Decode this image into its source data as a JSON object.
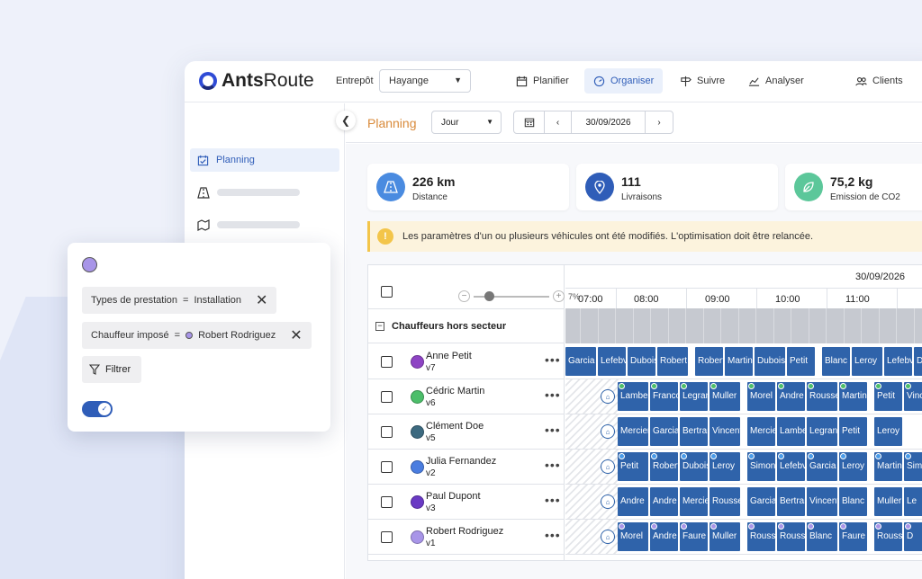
{
  "header": {
    "logo_bold": "Ants",
    "logo_rest": "Route",
    "entrepot_label": "Entrepôt",
    "entrepot_value": "Hayange",
    "nav": [
      {
        "label": "Planifier",
        "icon": "calendar-icon"
      },
      {
        "label": "Organiser",
        "icon": "speedometer-icon",
        "active": true
      },
      {
        "label": "Suivre",
        "icon": "signpost-icon"
      },
      {
        "label": "Analyser",
        "icon": "chart-icon"
      },
      {
        "label": "Clients",
        "icon": "people-icon"
      }
    ]
  },
  "sidebar": {
    "items": [
      {
        "label": "Planning",
        "icon": "calendar-check-icon"
      }
    ]
  },
  "toolbar": {
    "title": "Planning",
    "view": "Jour",
    "date": "30/09/2026"
  },
  "stats": [
    {
      "value": "226 km",
      "label": "Distance",
      "icon": "road-icon",
      "color": "#4a8be0"
    },
    {
      "value": "111",
      "label": "Livraisons",
      "icon": "pin-icon",
      "color": "#2f5db8"
    },
    {
      "value": "75,2 kg",
      "label": "Emission de CO2",
      "icon": "leaf-icon",
      "color": "#5cc79a"
    }
  ],
  "warning": {
    "text": "Les paramètres d'un ou plusieurs véhicules ont été modifiés. L'optimisation doit être relancée."
  },
  "timeline": {
    "date": "30/09/2026",
    "zoom": "7%",
    "hours": [
      "07:00",
      "08:00",
      "09:00",
      "10:00",
      "11:00"
    ],
    "section": "Chauffeurs hors secteur"
  },
  "drivers": [
    {
      "name": "Anne Petit",
      "vehicle": "v7",
      "color": "#8e44c4",
      "stop_color": null,
      "stops": [
        "Garcia",
        "Lefebvre",
        "Dubois",
        "Robert",
        "Robert",
        "Martin",
        "Dubois",
        "Petit",
        "Blanc",
        "Leroy",
        "Lefebvre",
        "Dubois"
      ]
    },
    {
      "name": "Cédric Martin",
      "vehicle": "v6",
      "color": "#4cbe6a",
      "stop_color": "#4cbe6a",
      "stops": [
        "Lambert",
        "Francois",
        "Legrand",
        "Muller",
        "Morel",
        "Andre",
        "Rousseau",
        "Martin",
        "Petit",
        "Vincent"
      ]
    },
    {
      "name": "Clément Doe",
      "vehicle": "v5",
      "color": "#3d6a80",
      "stop_color": null,
      "stops": [
        "Mercier",
        "Garcia",
        "Bertrand",
        "Vincent",
        "Mercier",
        "Lambert",
        "Legrand",
        "Petit",
        "Leroy"
      ]
    },
    {
      "name": "Julia Fernandez",
      "vehicle": "v2",
      "color": "#4a7de0",
      "stop_color": "#4a9be8",
      "stops": [
        "Petit",
        "Robert",
        "Dubois",
        "Leroy",
        "Simon",
        "Lefebvre",
        "Garcia",
        "Leroy",
        "Martin",
        "Simon"
      ]
    },
    {
      "name": "Paul Dupont",
      "vehicle": "v3",
      "color": "#6a3ac4",
      "stop_color": null,
      "stops": [
        "Andre",
        "Andre",
        "Mercier",
        "Rousseau",
        "Garcia",
        "Bertrand",
        "Vincent",
        "Blanc",
        "Muller",
        "Le"
      ]
    },
    {
      "name": "Robert Rodriguez",
      "vehicle": "v1",
      "color": "#a895e8",
      "stop_color": "#a895e8",
      "stops": [
        "Morel",
        "Andre",
        "Faure",
        "Muller",
        "Rousseau",
        "Rousseau",
        "Blanc",
        "Faure",
        "Rousseau",
        "D"
      ]
    }
  ],
  "filter": {
    "chips": [
      {
        "field": "Types de prestation",
        "op": "=",
        "value": "Installation",
        "dot": false
      },
      {
        "field": "Chauffeur imposé",
        "op": "=",
        "value": "Robert Rodriguez",
        "dot": true
      }
    ],
    "button": "Filtrer",
    "toggle_on": true
  }
}
